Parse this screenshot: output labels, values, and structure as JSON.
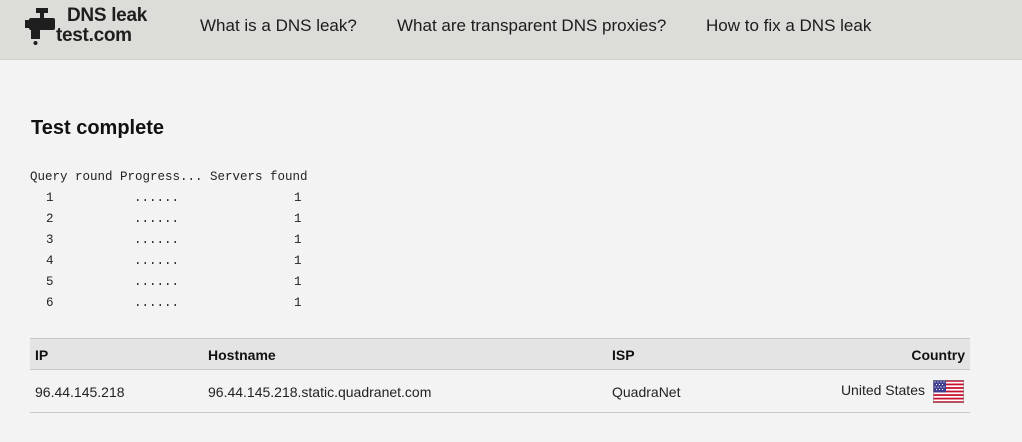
{
  "header": {
    "logo_line1": "DNS leak",
    "logo_line2": "test.com",
    "nav": [
      "What is a DNS leak?",
      "What are transparent DNS proxies?",
      "How to fix a DNS leak"
    ]
  },
  "main": {
    "title": "Test complete",
    "query_header": "Query round Progress... Servers found",
    "query_rounds": [
      {
        "round": "1",
        "progress": "......",
        "servers": "1"
      },
      {
        "round": "2",
        "progress": "......",
        "servers": "1"
      },
      {
        "round": "3",
        "progress": "......",
        "servers": "1"
      },
      {
        "round": "4",
        "progress": "......",
        "servers": "1"
      },
      {
        "round": "5",
        "progress": "......",
        "servers": "1"
      },
      {
        "round": "6",
        "progress": "......",
        "servers": "1"
      }
    ],
    "results": {
      "headers": [
        "IP",
        "Hostname",
        "ISP",
        "Country"
      ],
      "rows": [
        {
          "ip": "96.44.145.218",
          "hostname": "96.44.145.218.static.quadranet.com",
          "isp": "QuadraNet",
          "country": "United States",
          "flag_icon": "us-flag-icon"
        }
      ]
    }
  },
  "colors": {
    "topbar": "#dcdcd8",
    "background": "#f3f3f3",
    "table_header": "#e4e4e4",
    "border": "#c8c8c8"
  }
}
